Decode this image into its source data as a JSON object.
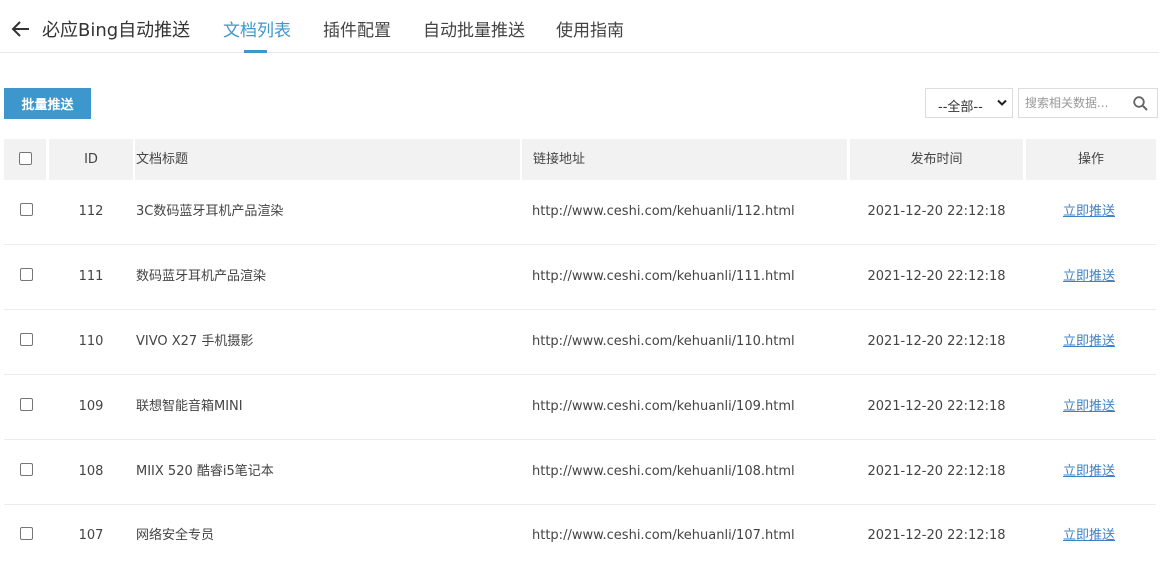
{
  "header": {
    "title": "必应Bing自动推送",
    "tabs": [
      {
        "label": "文档列表",
        "active": true
      },
      {
        "label": "插件配置",
        "active": false
      },
      {
        "label": "自动批量推送",
        "active": false
      },
      {
        "label": "使用指南",
        "active": false
      }
    ]
  },
  "toolbar": {
    "batch_label": "批量推送",
    "filter_selected": "--全部--",
    "search_placeholder": "搜索相关数据..."
  },
  "table": {
    "columns": [
      "ID",
      "文档标题",
      "链接地址",
      "发布时间",
      "操作"
    ],
    "rows": [
      {
        "id": "112",
        "title": "3C数码蓝牙耳机产品渲染",
        "url": "http://www.ceshi.com/kehuanli/112.html",
        "date": "2021-12-20 22:12:18",
        "action": "立即推送"
      },
      {
        "id": "111",
        "title": "数码蓝牙耳机产品渲染",
        "url": "http://www.ceshi.com/kehuanli/111.html",
        "date": "2021-12-20 22:12:18",
        "action": "立即推送"
      },
      {
        "id": "110",
        "title": "VIVO X27 手机摄影",
        "url": "http://www.ceshi.com/kehuanli/110.html",
        "date": "2021-12-20 22:12:18",
        "action": "立即推送"
      },
      {
        "id": "109",
        "title": "联想智能音箱MINI",
        "url": "http://www.ceshi.com/kehuanli/109.html",
        "date": "2021-12-20 22:12:18",
        "action": "立即推送"
      },
      {
        "id": "108",
        "title": "MIIX 520 酷睿i5笔记本",
        "url": "http://www.ceshi.com/kehuanli/108.html",
        "date": "2021-12-20 22:12:18",
        "action": "立即推送"
      },
      {
        "id": "107",
        "title": "网络安全专员",
        "url": "http://www.ceshi.com/kehuanli/107.html",
        "date": "2021-12-20 22:12:18",
        "action": "立即推送"
      }
    ]
  },
  "colors": {
    "accent": "#3d97cc",
    "link": "#3d82c4",
    "header_bg": "#f2f2f2"
  },
  "icons": [
    "back-arrow-icon",
    "chevron-down-icon",
    "search-icon"
  ]
}
